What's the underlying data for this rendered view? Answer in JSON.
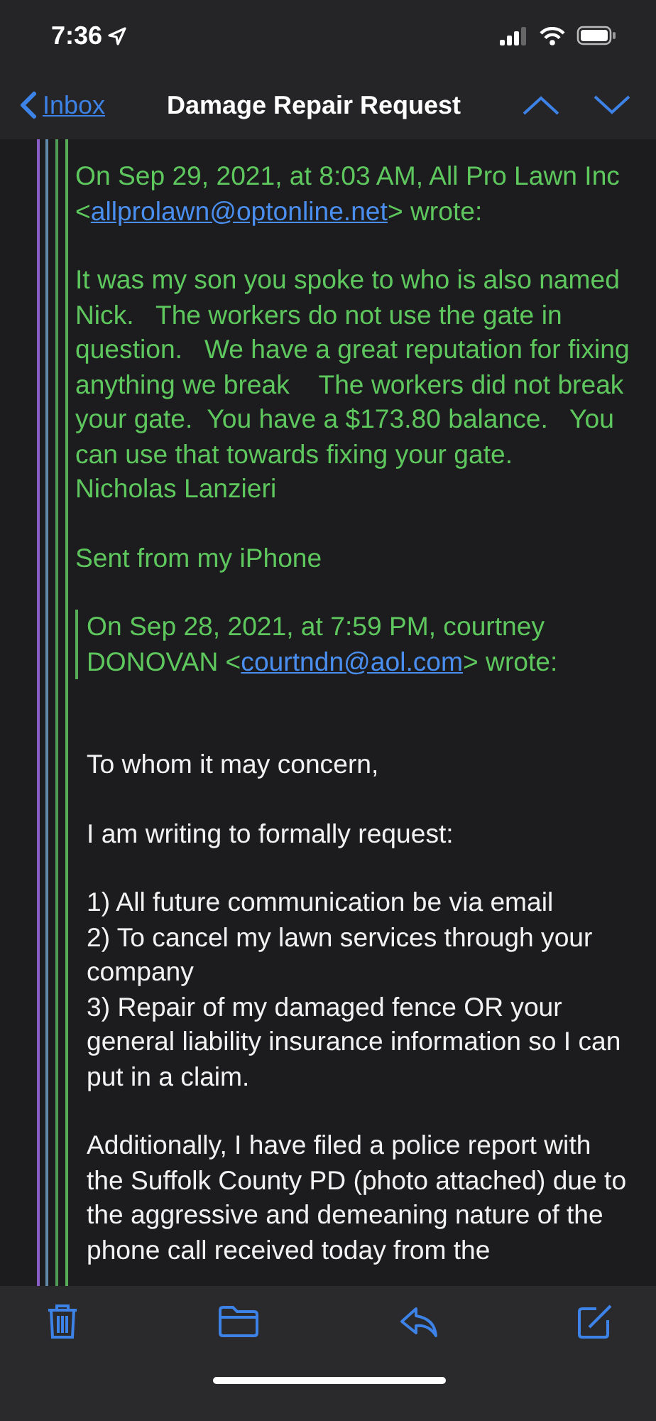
{
  "status_bar": {
    "time": "7:36"
  },
  "nav": {
    "back": "Inbox",
    "title": "Damage Repair Request"
  },
  "reply": {
    "header": {
      "before": "On Sep 29, 2021, at 8:03 AM, All Pro Lawn Inc <",
      "email": "allprolawn@optonline.net",
      "after": "> wrote:"
    },
    "paragraphs": [
      "It was my son you spoke to who is also named Nick.   The workers do not use the gate in question.   We have a great reputation for fixing anything we break    The workers did not break your gate.  You have a $173.80 balance.   You can use that towards fixing your gate.",
      "Nicholas Lanzieri",
      "Sent from my iPhone"
    ],
    "quoted": {
      "header": {
        "before": "On Sep 28, 2021, at 7:59 PM, courtney DONOVAN <",
        "email": "courtndn@aol.com",
        "after": "> wrote:"
      },
      "paragraphs": [
        "To whom it may concern,",
        "I am writing to formally request:",
        "1) All future communication be via email\n2) To cancel my lawn services through your company\n3) Repair of my damaged fence OR your general liability insurance information so I can put in a claim.",
        "Additionally, I have filed a police report with the Suffolk County PD (photo attached) due to the aggressive and demeaning nature of the phone call received today from the"
      ]
    }
  },
  "toolbar": [
    {
      "kind": "trash"
    },
    {
      "kind": "folder"
    },
    {
      "kind": "reply"
    },
    {
      "kind": "compose"
    }
  ]
}
